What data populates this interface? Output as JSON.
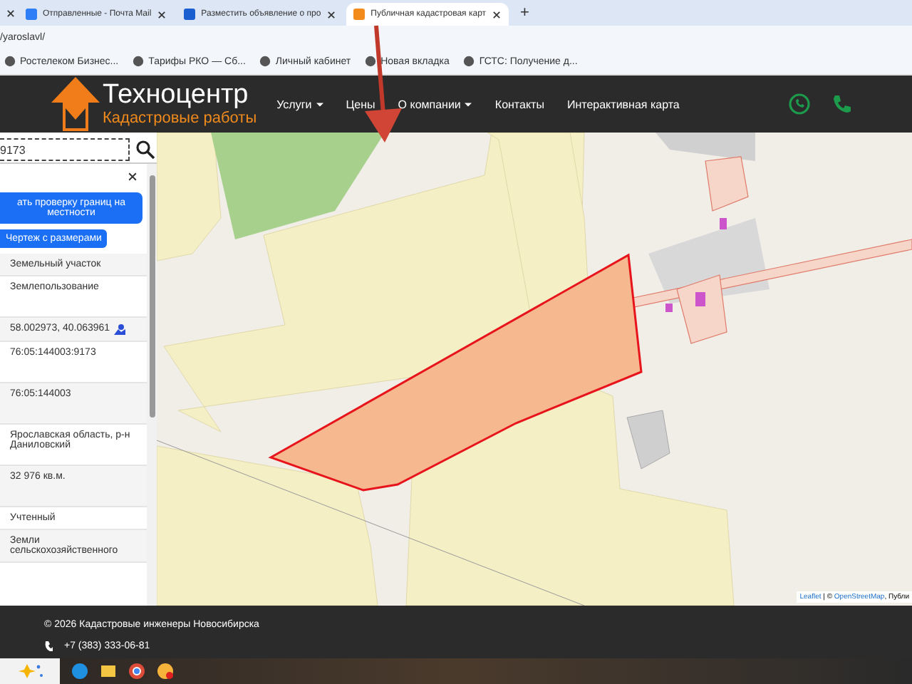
{
  "browser": {
    "tabs": [
      {
        "title": "Отправленные - Почта Mail",
        "selected": false
      },
      {
        "title": "Разместить объявление о про",
        "selected": false
      },
      {
        "title": "Публичная кадастровая карт",
        "selected": true
      }
    ],
    "new_tab": "+",
    "address": "/yaroslavl/",
    "bookmarks": [
      "Ростелеком Бизнес...",
      "Тарифы РКО — Сб...",
      "Личный кабинет",
      "Новая вкладка",
      "ГСТС: Получение д..."
    ]
  },
  "header": {
    "logo_title": "Техноцентр",
    "logo_subtitle": "Кадастровые работы",
    "nav": [
      {
        "label": "Услуги",
        "dropdown": true
      },
      {
        "label": "Цены",
        "dropdown": false
      },
      {
        "label": "О компании",
        "dropdown": true
      },
      {
        "label": "Контакты",
        "dropdown": false
      },
      {
        "label": "Интерактивная карта",
        "dropdown": false
      }
    ]
  },
  "sidebar": {
    "search": {
      "value": "9173"
    },
    "buttons": [
      {
        "label": "ать проверку границ на местности",
        "kind": "wide"
      },
      {
        "label": "Чертеж с размерами",
        "kind": "small"
      }
    ],
    "rows": [
      {
        "value": "Земельный участок",
        "kind": "text"
      },
      {
        "value": "Землепользование",
        "kind": "tall"
      },
      {
        "value": "58.002973, 40.063961",
        "kind": "coords"
      },
      {
        "value": "76:05:144003:9173",
        "kind": "tall"
      },
      {
        "value": "76:05:144003",
        "kind": "tall"
      },
      {
        "value": "Ярославская область, р-н Даниловский",
        "kind": "tall"
      },
      {
        "value": "32 976 кв.м.",
        "kind": "tall"
      },
      {
        "value": "Учтенный",
        "kind": "text"
      },
      {
        "value": "Земли сельскохозяйственного",
        "kind": "text"
      }
    ]
  },
  "map": {
    "attribution": [
      {
        "text": "Leaflet",
        "link": true
      },
      {
        "text": " | © ",
        "link": false
      },
      {
        "text": "OpenStreetMap",
        "link": true
      },
      {
        "text": ", Публи",
        "link": false
      }
    ]
  },
  "footer": {
    "copyright": "© 2026 Кадастровые инженеры Новосибирска",
    "phone": "+7 (383) 333-06-81"
  }
}
